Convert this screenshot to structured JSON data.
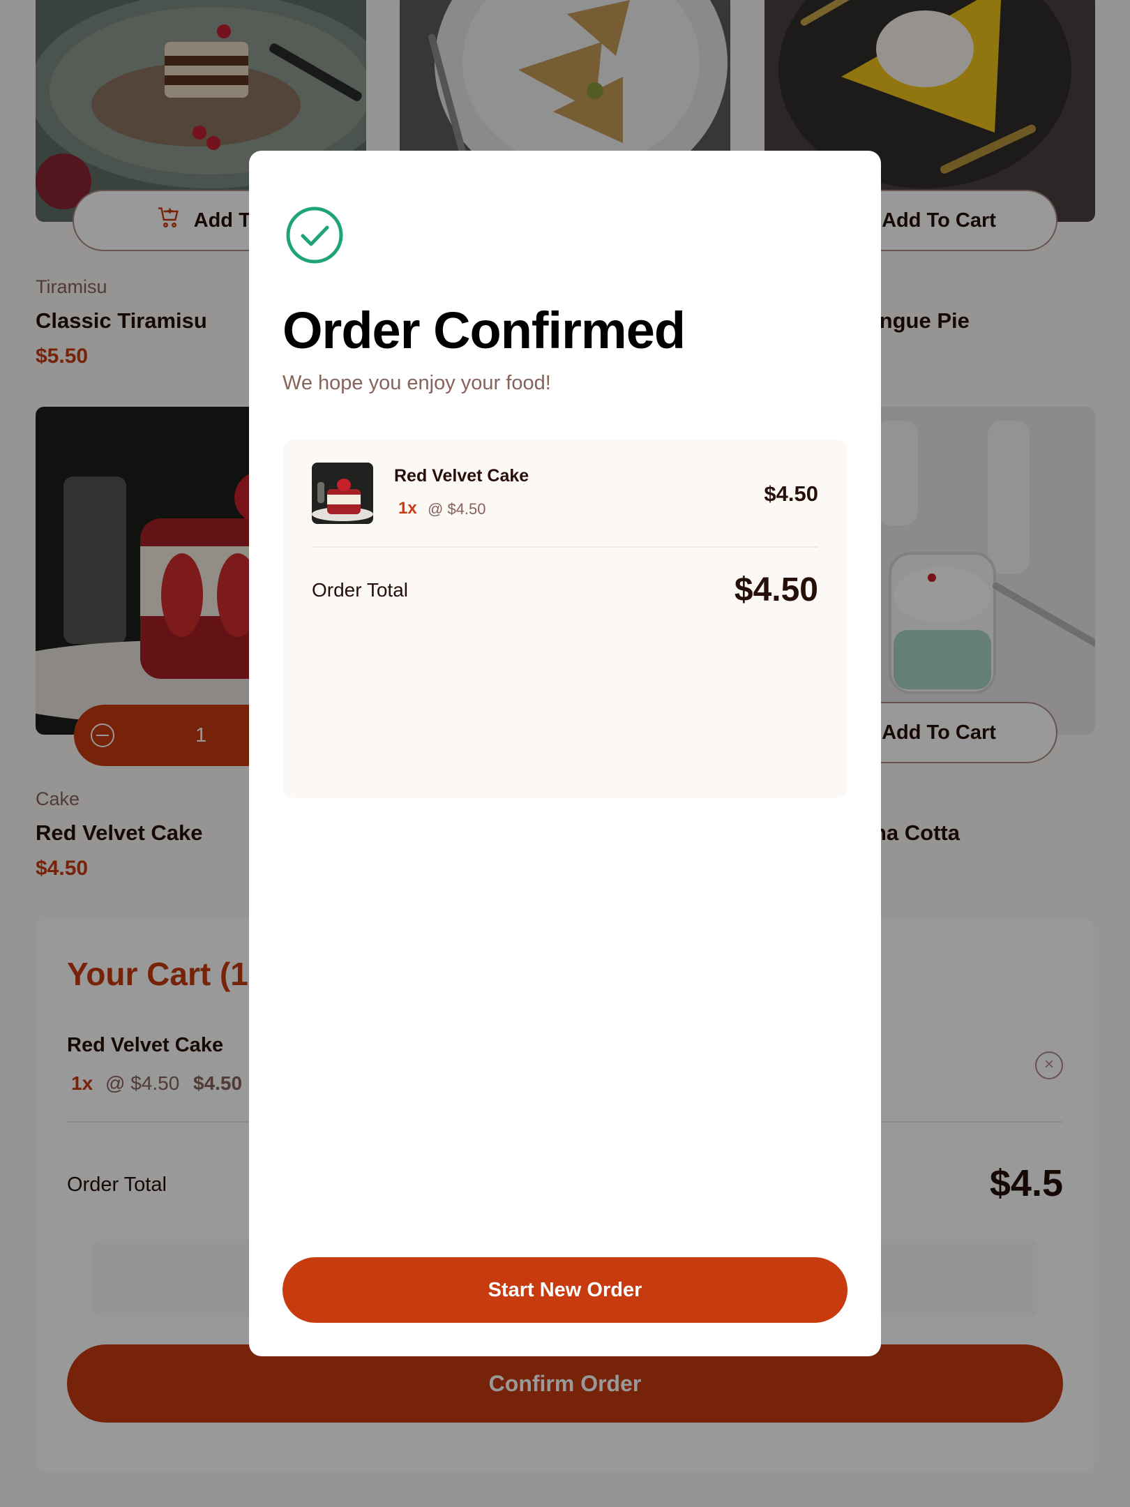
{
  "products": [
    {
      "category": "Tiramisu",
      "name": "Classic Tiramisu",
      "price": "$5.50",
      "button_label": "Add To Cart",
      "button_visible": "Add To C"
    },
    {
      "category": "",
      "name": "",
      "price": "",
      "button_label": "",
      "button_visible": ""
    },
    {
      "category": "",
      "name": "Meringue Pie",
      "name_visible": "ringue Pie",
      "price": "",
      "button_label": "Add To Cart",
      "button_visible": "Add To Cart"
    },
    {
      "category": "Cake",
      "name": "Red Velvet Cake",
      "price": "$4.50",
      "quantity": "1"
    },
    {
      "category": "",
      "name": "",
      "price": "",
      "button_label": "",
      "button_visible": ""
    },
    {
      "category": "",
      "name": "Panna Cotta",
      "name_visible": "na Cotta",
      "price": "",
      "button_label": "Add To Cart",
      "button_visible": "Add To Cart"
    }
  ],
  "cart": {
    "title_visible": "Your Cart (1",
    "item_name": "Red Velvet Cake",
    "item_qty": "1x",
    "item_unit": "@ $4.50",
    "item_total": "$4.50",
    "total_label": "Order Total",
    "total_value_visible": "$4.5",
    "confirm_label": "Confirm Order"
  },
  "modal": {
    "title": "Order Confirmed",
    "subtitle": "We hope you enjoy your food!",
    "item_name": "Red Velvet Cake",
    "item_qty": "1x",
    "item_unit": "@ $4.50",
    "item_price": "$4.50",
    "total_label": "Order Total",
    "total_value": "$4.50",
    "button_label": "Start New Order"
  },
  "colors": {
    "accent": "#c73b0f",
    "success": "#1ea475",
    "text_dark": "#260f08",
    "text_muted": "#87635a"
  },
  "icons": [
    "add-to-cart-icon",
    "decrement-icon",
    "remove-item-icon",
    "order-confirmed-check-icon"
  ]
}
